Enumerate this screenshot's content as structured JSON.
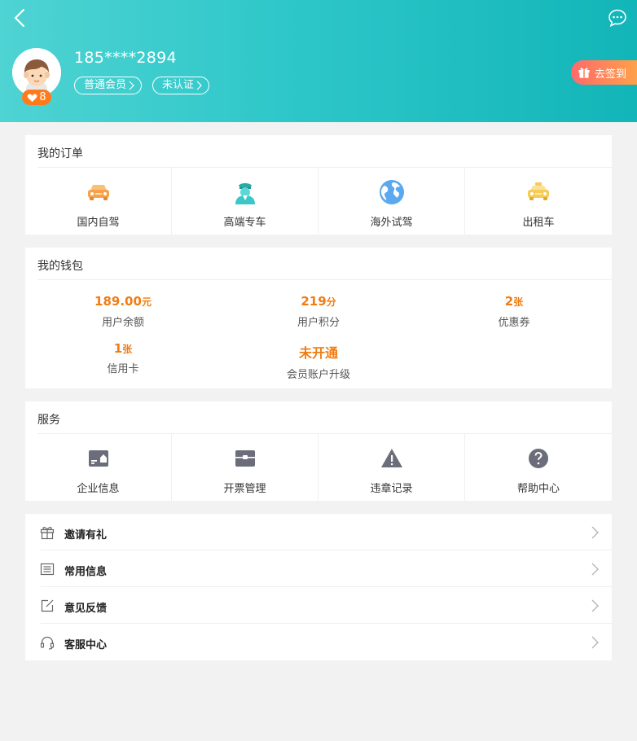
{
  "header": {
    "phone": "185****2894",
    "level": "8",
    "member_tag": "普通会员",
    "auth_tag": "未认证",
    "checkin_label": "去签到"
  },
  "orders": {
    "title": "我的订单",
    "items": [
      {
        "label": "国内自驾",
        "icon": "car-icon",
        "color": "#f7a24a"
      },
      {
        "label": "高端专车",
        "icon": "chauffeur-icon",
        "color": "#3cc6c6"
      },
      {
        "label": "海外试驾",
        "icon": "globe-icon",
        "color": "#5aa8f0"
      },
      {
        "label": "出租车",
        "icon": "taxi-icon",
        "color": "#f6cc55"
      }
    ]
  },
  "wallet": {
    "title": "我的钱包",
    "balance": {
      "value": "189.00",
      "unit": "元",
      "label": "用户余额"
    },
    "points": {
      "value": "219",
      "unit": "分",
      "label": "用户积分"
    },
    "coupons": {
      "value": "2",
      "unit": "张",
      "label": "优惠券"
    },
    "credit_cards": {
      "value": "1",
      "unit": "张",
      "label": "信用卡"
    },
    "upgrade": {
      "value": "未开通",
      "label": "会员账户升级"
    }
  },
  "services": {
    "title": "服务",
    "items": [
      {
        "label": "企业信息",
        "icon": "enterprise-card-icon"
      },
      {
        "label": "开票管理",
        "icon": "invoice-icon"
      },
      {
        "label": "违章记录",
        "icon": "warning-icon"
      },
      {
        "label": "帮助中心",
        "icon": "help-icon"
      }
    ]
  },
  "menu": [
    {
      "label": "邀请有礼",
      "icon": "gift-icon"
    },
    {
      "label": "常用信息",
      "icon": "list-icon"
    },
    {
      "label": "意见反馈",
      "icon": "edit-icon"
    },
    {
      "label": "客服中心",
      "icon": "headset-icon"
    }
  ],
  "colors": {
    "header_start": "#4fd3d3",
    "header_end": "#12b5b8",
    "accent_orange": "#f07c13",
    "checkin_start": "#ff6a6a",
    "checkin_end": "#ffa14a"
  }
}
